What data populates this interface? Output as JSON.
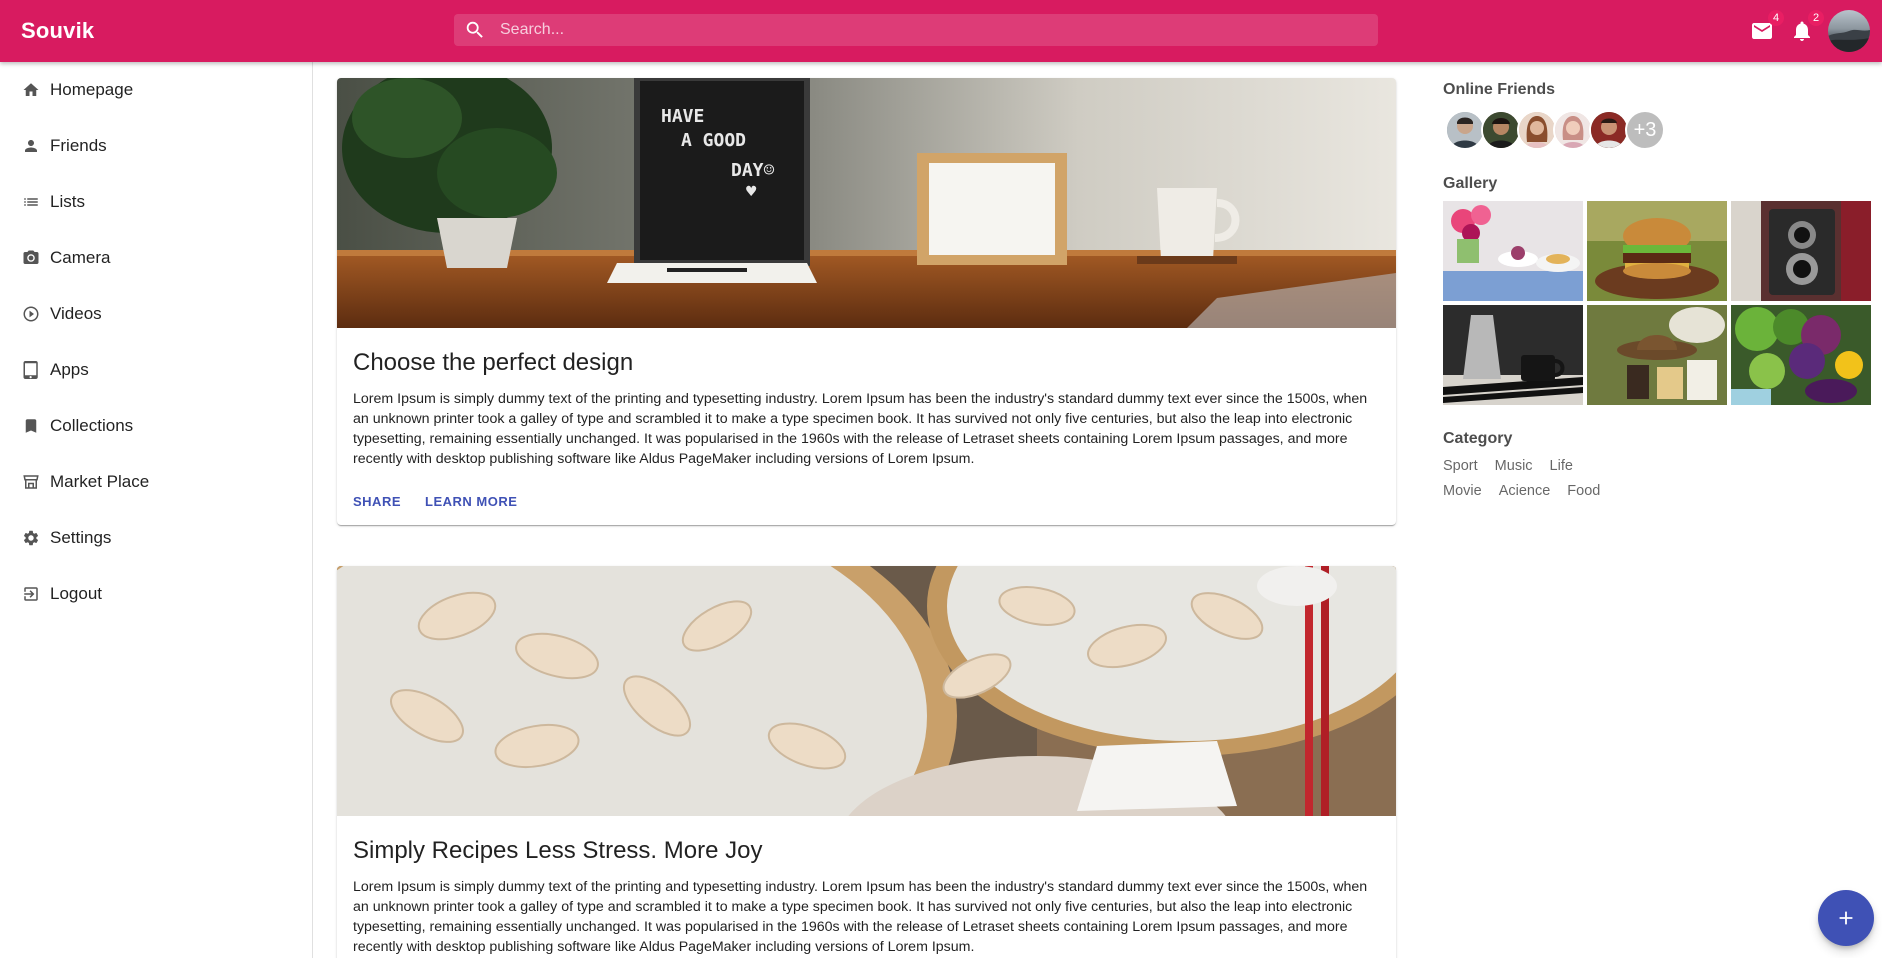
{
  "app": {
    "title": "Souvik"
  },
  "search": {
    "placeholder": "Search..."
  },
  "header": {
    "mail_badge": "4",
    "notifications_badge": "2"
  },
  "sidebar": {
    "items": [
      {
        "label": "Homepage",
        "icon": "home-icon"
      },
      {
        "label": "Friends",
        "icon": "person-icon"
      },
      {
        "label": "Lists",
        "icon": "list-icon"
      },
      {
        "label": "Camera",
        "icon": "camera-icon"
      },
      {
        "label": "Videos",
        "icon": "play-circle-icon"
      },
      {
        "label": "Apps",
        "icon": "tablet-icon"
      },
      {
        "label": "Collections",
        "icon": "bookmark-icon"
      },
      {
        "label": "Market Place",
        "icon": "storefront-icon"
      },
      {
        "label": "Settings",
        "icon": "gear-icon"
      },
      {
        "label": "Logout",
        "icon": "exit-icon"
      }
    ]
  },
  "feed": {
    "posts": [
      {
        "title": "Choose the perfect design",
        "body": "Lorem Ipsum is simply dummy text of the printing and typesetting industry. Lorem Ipsum has been the industry's standard dummy text ever since the 1500s, when an unknown printer took a galley of type and scrambled it to make a type specimen book. It has survived not only five centuries, but also the leap into electronic typesetting, remaining essentially unchanged. It was popularised in the 1960s with the release of Letraset sheets containing Lorem Ipsum passages, and more recently with desktop publishing software like Aldus PageMaker including versions of Lorem Ipsum.",
        "share_label": "Share",
        "learn_more_label": "Learn More",
        "image_caption": [
          "HAVE",
          "A GOOD",
          "DAY☺",
          "♥"
        ]
      },
      {
        "title": "Simply Recipes Less Stress. More Joy",
        "body": "Lorem Ipsum is simply dummy text of the printing and typesetting industry. Lorem Ipsum has been the industry's standard dummy text ever since the 1500s, when an unknown printer took a galley of type and scrambled it to make a type specimen book. It has survived not only five centuries, but also the leap into electronic typesetting, remaining essentially unchanged. It was popularised in the 1960s with the release of Letraset sheets containing Lorem Ipsum passages, and more recently with desktop publishing software like Aldus PageMaker including versions of Lorem Ipsum."
      }
    ]
  },
  "rightbar": {
    "online_friends": {
      "heading": "Online Friends",
      "more_count": "+3"
    },
    "gallery": {
      "heading": "Gallery"
    },
    "category": {
      "heading": "Category",
      "row1": [
        "Sport",
        "Music",
        "Life"
      ],
      "row2": [
        "Movie",
        "Acience",
        "Food"
      ]
    }
  },
  "colors": {
    "appbar": "#d81b60",
    "accent": "#3f51b5",
    "badge": "#e91e63"
  }
}
